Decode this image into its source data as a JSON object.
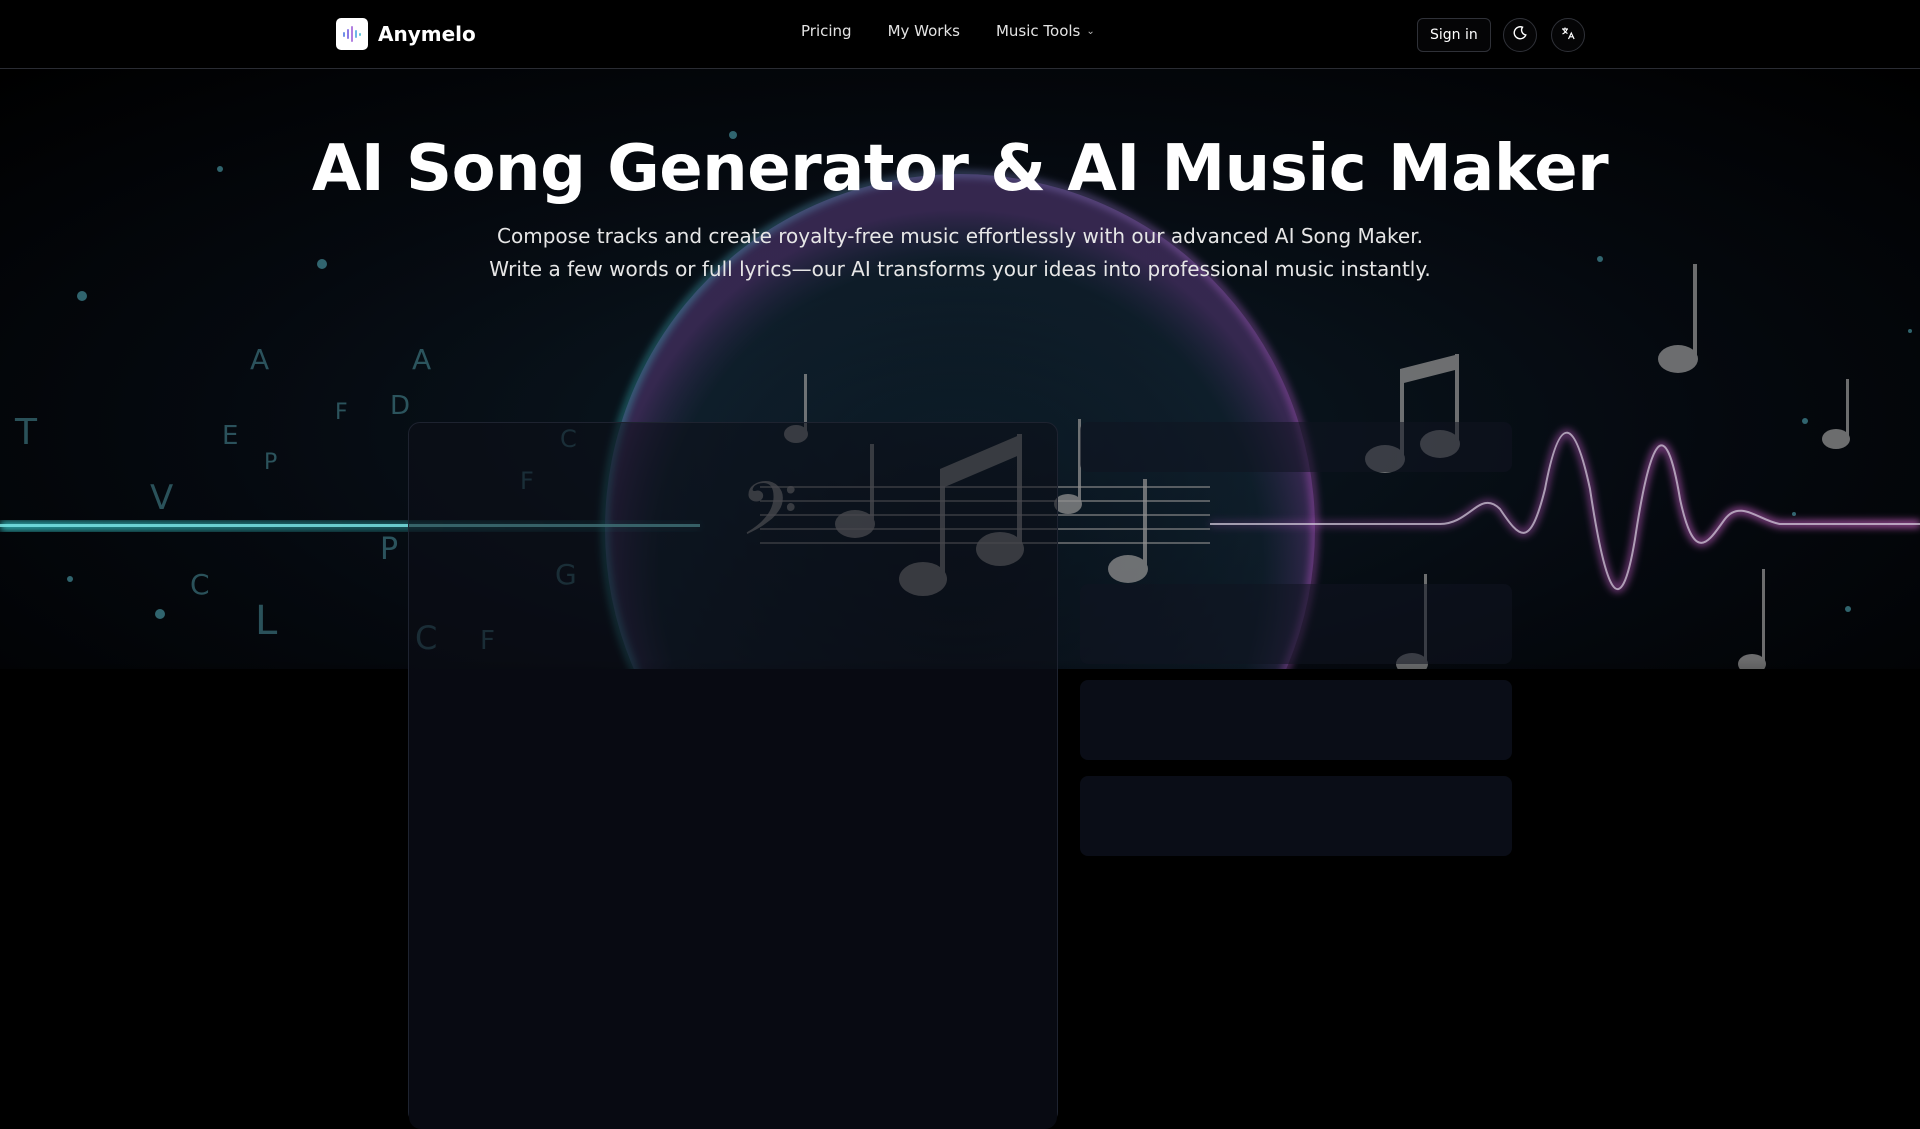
{
  "header": {
    "brand": "Anymelo",
    "nav": [
      {
        "label": "Pricing"
      },
      {
        "label": "My Works"
      },
      {
        "label": "Music Tools",
        "has_dropdown": true
      }
    ],
    "sign_in_label": "Sign in",
    "icons": [
      "logo-icon",
      "moon-icon",
      "language-icon"
    ]
  },
  "hero": {
    "title": "AI Song Generator & AI Music Maker",
    "subtitle_line1": "Compose tracks and create royalty-free music effortlessly with our advanced AI Song Maker.",
    "subtitle_line2": "Write a few words or full lyrics—our AI transforms your ideas into professional music instantly."
  },
  "colors": {
    "background": "#000000",
    "teal_glow": "#34c6c9",
    "magenta_glow": "#c85ad6"
  }
}
